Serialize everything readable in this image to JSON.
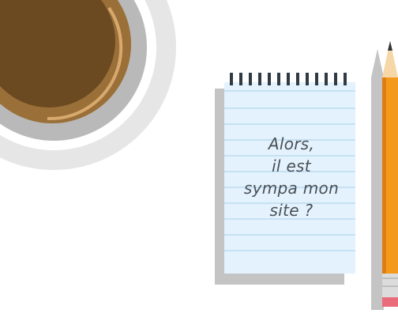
{
  "note": {
    "lines": [
      "Alors,",
      "il est",
      "sympa mon",
      "site ?"
    ]
  },
  "colors": {
    "background": "#ffffff",
    "coffee": "#6b4a22",
    "cup_rim": "#9a7038",
    "saucer": "#e6e6e6",
    "notepad": "#e3f2fd",
    "notepad_lines": "#b4d7ec",
    "pencil_body": "#f39a1c",
    "eraser": "#ea6b7b"
  },
  "icons": [
    "coffee-cup-icon",
    "notepad-icon",
    "pencil-icon"
  ]
}
